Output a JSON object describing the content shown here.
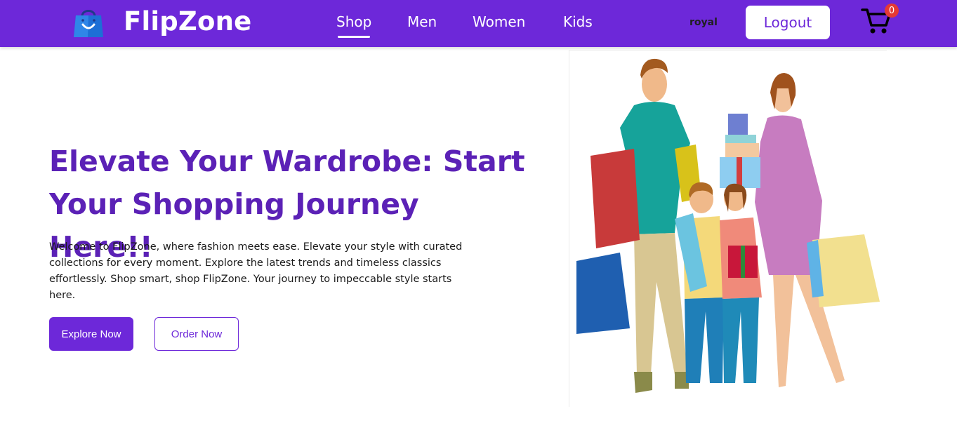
{
  "nav": {
    "brand": "FlipZone",
    "links": [
      "Shop",
      "Men",
      "Women",
      "Kids"
    ],
    "username": "royal",
    "logout_label": "Logout",
    "cart_count": "0"
  },
  "hero": {
    "title": "Elevate Your Wardrobe: Start Your Shopping Journey Here!!",
    "description": "Welcome to FlipZone, where fashion meets ease. Elevate your style with curated collections for every moment. Explore the latest trends and timeless classics effortlessly. Shop smart, shop FlipZone. Your journey to impeccable style starts here.",
    "explore_label": "Explore Now",
    "order_label": "Order Now"
  },
  "colors": {
    "primary": "#6d28d9",
    "title": "#5b21b6",
    "badge": "#e53935"
  },
  "icons": {
    "logo": "shopping-bag-icon",
    "cart": "cart-icon"
  }
}
